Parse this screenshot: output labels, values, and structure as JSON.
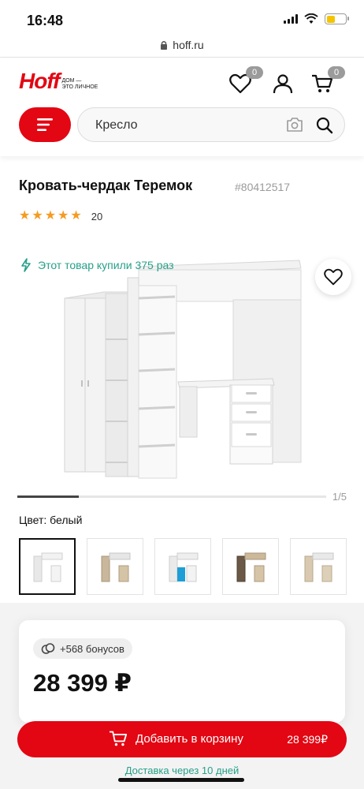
{
  "status": {
    "time": "16:48"
  },
  "browser": {
    "url": "hoff.ru"
  },
  "header": {
    "logo_word": "Hoff",
    "logo_tagline": "ДОМ —\nЭТО ЛИЧНОЕ",
    "favorites_count": "0",
    "cart_count": "0",
    "search_value": "Кресло"
  },
  "product": {
    "title": "Кровать-чердак Теремок",
    "sku": "#80412517",
    "rating": 5,
    "reviews_count": "20",
    "bought_note": "Этот товар купили 375 раз",
    "gallery_counter": "1/5",
    "gallery_progress": 0.2,
    "color_label": "Цвет: белый",
    "swatches": [
      "white",
      "oak-white",
      "white-blue",
      "oak-dark",
      "oak-light"
    ],
    "bonus": "+568 бонусов",
    "price": "28 399 ₽"
  },
  "cart": {
    "button_label": "Добавить в корзину",
    "button_price": "28 399₽",
    "delivery": "Доставка через 10 дней"
  },
  "colors": {
    "brand": "#e30613",
    "accent_green": "#27a08a",
    "star": "#f59b22"
  }
}
